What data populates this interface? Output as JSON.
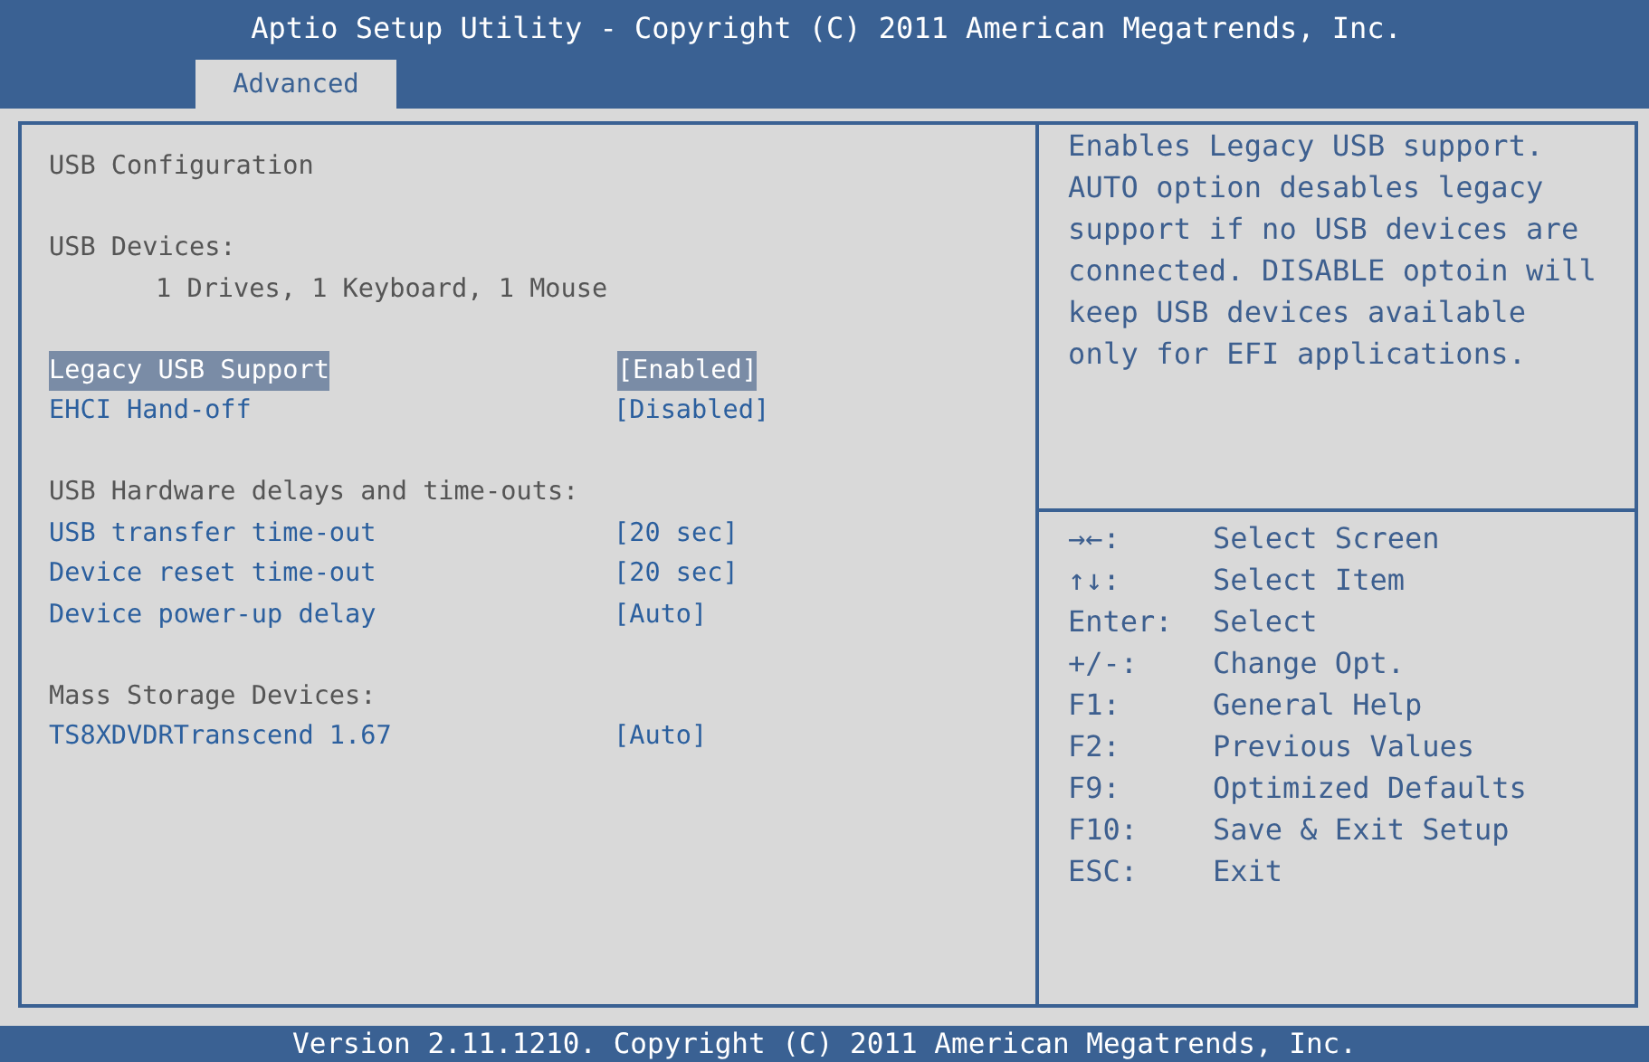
{
  "window": {
    "title": "Aptio Setup Utility - Copyright (C) 2011 American Megatrends, Inc."
  },
  "tabs": [
    {
      "label": "Advanced",
      "selected": true
    }
  ],
  "sections": [
    {
      "items": [
        {
          "kind": "heading",
          "label": "USB Configuration"
        }
      ]
    },
    {
      "items": [
        {
          "kind": "heading",
          "label": "USB Devices:"
        },
        {
          "kind": "info",
          "label": "1 Drives, 1 Keyboard, 1 Mouse"
        }
      ]
    },
    {
      "items": [
        {
          "kind": "setting",
          "label": "Legacy USB Support",
          "value": "[Enabled]",
          "selected": true
        },
        {
          "kind": "setting",
          "label": "EHCI Hand-off",
          "value": "[Disabled]",
          "selected": false
        }
      ]
    },
    {
      "items": [
        {
          "kind": "heading",
          "label": "USB Hardware delays and time-outs:"
        },
        {
          "kind": "setting",
          "label": "USB transfer time-out",
          "value": "[20 sec]",
          "selected": false
        },
        {
          "kind": "setting",
          "label": "Device reset time-out",
          "value": "[20 sec]",
          "selected": false
        },
        {
          "kind": "setting",
          "label": "Device power-up delay",
          "value": "[Auto]",
          "selected": false
        }
      ]
    },
    {
      "items": [
        {
          "kind": "heading",
          "label": "Mass Storage Devices:"
        },
        {
          "kind": "setting",
          "label": "TS8XDVDRTranscend 1.67",
          "value": "[Auto]",
          "selected": false
        }
      ]
    }
  ],
  "help_text": "Enables Legacy USB support. AUTO option desables legacy support if no USB devices are connected. DISABLE optoin will keep USB devices available only for EFI applications.",
  "keys": [
    {
      "key": "→←:",
      "action": "Select Screen"
    },
    {
      "key": "↑↓:",
      "action": "Select Item"
    },
    {
      "key": "Enter:",
      "action": "Select"
    },
    {
      "key": "+/-:",
      "action": "Change Opt."
    },
    {
      "key": "F1:",
      "action": "General Help"
    },
    {
      "key": "F2:",
      "action": "Previous Values"
    },
    {
      "key": "F9:",
      "action": "Optimized Defaults"
    },
    {
      "key": "F10:",
      "action": "Save & Exit Setup"
    },
    {
      "key": "ESC:",
      "action": "Exit"
    }
  ],
  "status_bar": "Version 2.11.1210. Copyright (C) 2011 American Megatrends, Inc."
}
